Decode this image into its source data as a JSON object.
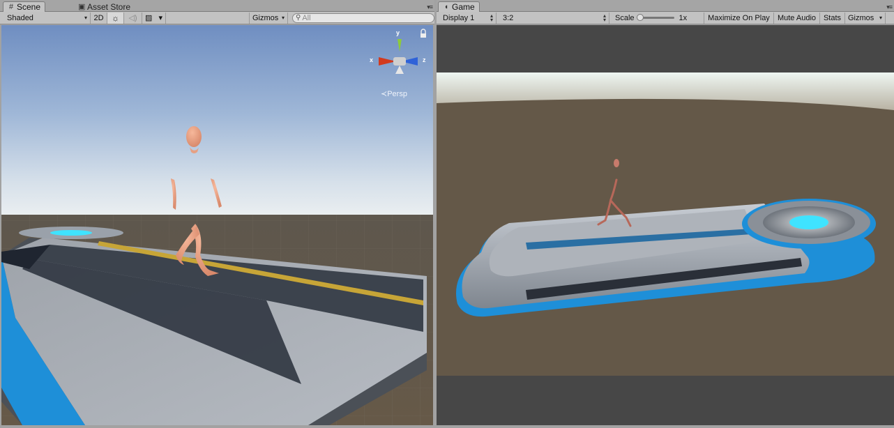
{
  "scene": {
    "tabs": [
      {
        "label": "Scene",
        "icon": "hash-grid-icon",
        "active": true
      },
      {
        "label": "Asset Store",
        "icon": "store-bag-icon",
        "active": false
      }
    ],
    "toolbar": {
      "draw_mode": "Shaded",
      "mode_2d": "2D",
      "gizmos_label": "Gizmos",
      "search_placeholder": "All"
    },
    "axis_labels": {
      "x": "x",
      "y": "y",
      "z": "z"
    },
    "projection_label": "Persp"
  },
  "game": {
    "tab": {
      "label": "Game",
      "icon": "pacman-icon"
    },
    "toolbar": {
      "display": "Display 1",
      "aspect": "3:2",
      "scale_label": "Scale",
      "scale_value": "1x",
      "maximize_on_play": "Maximize On Play",
      "mute_audio": "Mute Audio",
      "stats": "Stats",
      "gizmos_label": "Gizmos"
    }
  },
  "colors": {
    "sky_top": "#6f8ec1",
    "ground": "#645848",
    "platform_blue": "#1e8fd8",
    "glow_cyan": "#3fe3ff",
    "axis_x": "#d23a1e",
    "axis_y": "#8ecb3a",
    "axis_z": "#2f62d8"
  }
}
